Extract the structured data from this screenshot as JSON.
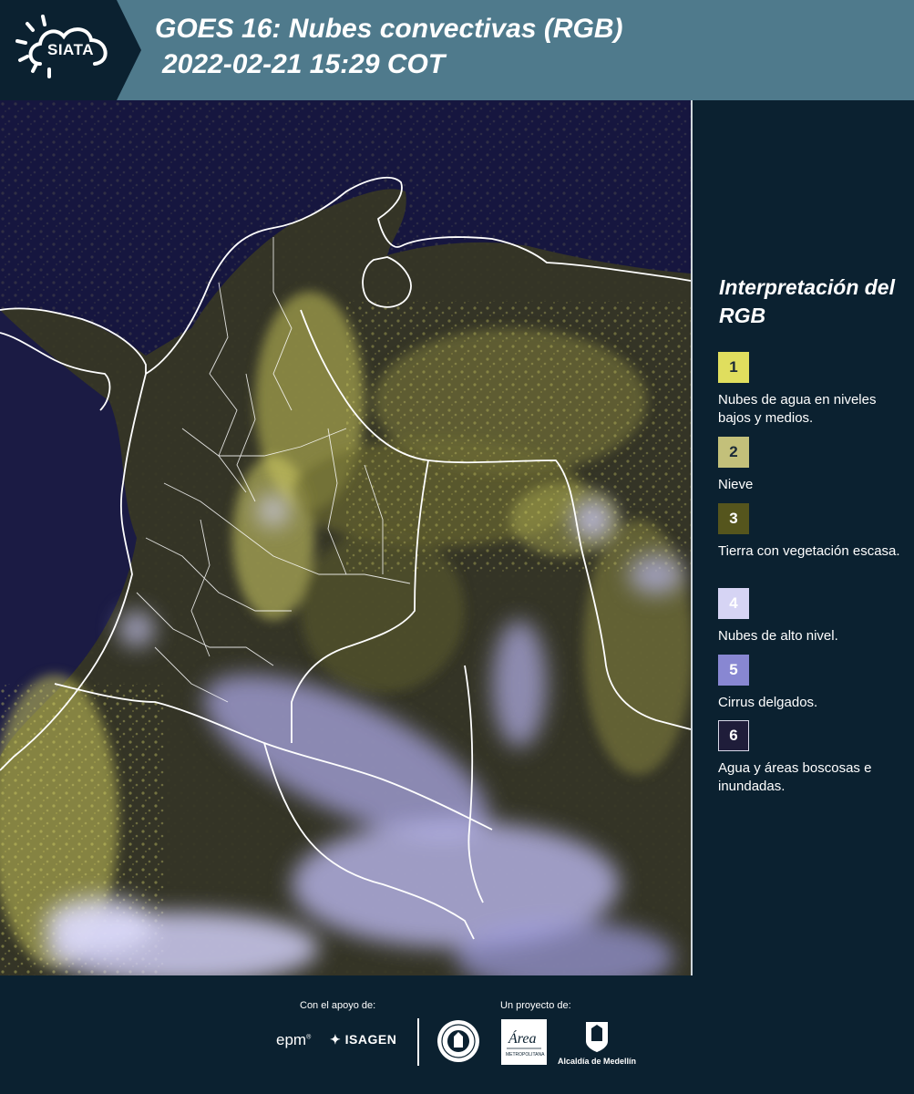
{
  "header": {
    "logo_text": "SIATA",
    "title_line1": "GOES 16: Nubes convectivas (RGB)",
    "title_line2": "2022-02-21 15:29 COT"
  },
  "map": {
    "description_icon": "satellite-rgb-map-colombia"
  },
  "legend": {
    "title": "Interpretación del RGB",
    "items": [
      {
        "number": "1",
        "label": "Nubes de agua en niveles bajos y medios.",
        "color": "#e0de5e"
      },
      {
        "number": "2",
        "label": "Nieve",
        "color": "#c3c07a"
      },
      {
        "number": "3",
        "label": "Tierra con vegetación escasa.",
        "color": "#55551d"
      },
      {
        "number": "4",
        "label": "Nubes de alto nivel.",
        "color": "#d6d4f4"
      },
      {
        "number": "5",
        "label": "Cirrus delgados.",
        "color": "#8887d2"
      },
      {
        "number": "6",
        "label": "Agua y áreas boscosas e inundadas.",
        "color": "#1f1d3a"
      }
    ]
  },
  "footer": {
    "support_label": "Con el apoyo de:",
    "project_label": "Un proyecto de:",
    "epm": "epm",
    "isagen": "ISAGEN",
    "area_metropolitana": "Área",
    "area_subtitle": "METROPOLITANA",
    "alcaldia": "Alcaldía de Medellín"
  },
  "colors": {
    "header_bg": "#4f7a8c",
    "page_bg": "#0b2130",
    "map_ocean": "#15153e"
  }
}
